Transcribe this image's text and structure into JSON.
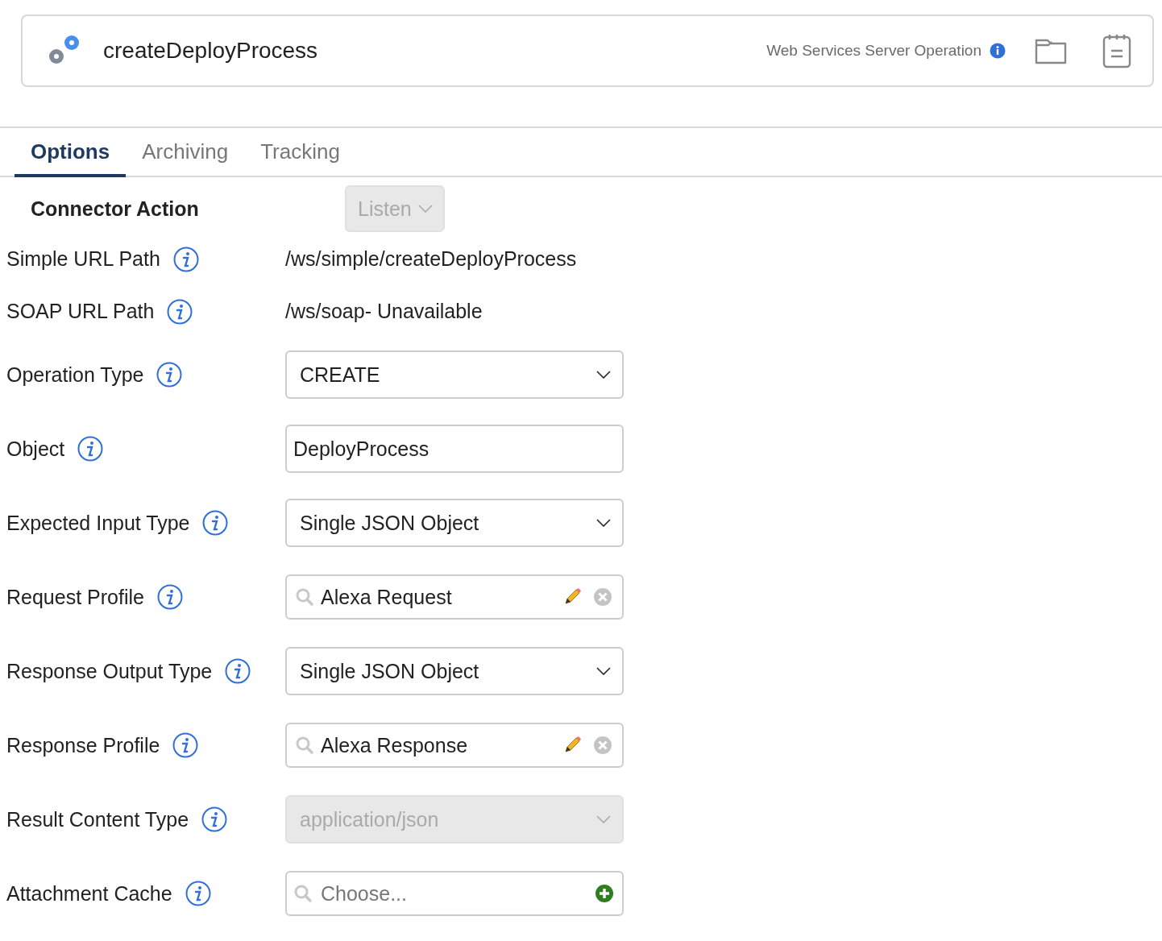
{
  "header": {
    "title": "createDeployProcess",
    "subtitle": "Web Services Server Operation"
  },
  "tabs": [
    {
      "label": "Options",
      "selected": true
    },
    {
      "label": "Archiving",
      "selected": false
    },
    {
      "label": "Tracking",
      "selected": false
    }
  ],
  "connector_action": {
    "label": "Connector Action",
    "value": "Listen",
    "disabled": true
  },
  "fields": [
    {
      "label": "Simple URL Path",
      "kind": "text",
      "value": "/ws/simple/createDeployProcess"
    },
    {
      "label": "SOAP URL Path",
      "kind": "text",
      "value": "/ws/soap- Unavailable"
    },
    {
      "label": "Operation Type",
      "kind": "select",
      "value": "CREATE",
      "disabled": false
    },
    {
      "label": "Object",
      "kind": "input",
      "value": "DeployProcess"
    },
    {
      "label": "Expected Input Type",
      "kind": "select",
      "value": "Single JSON Object",
      "disabled": false
    },
    {
      "label": "Request Profile",
      "kind": "profile",
      "value": "Alexa Request"
    },
    {
      "label": "Response Output Type",
      "kind": "select",
      "value": "Single JSON Object",
      "disabled": false
    },
    {
      "label": "Response Profile",
      "kind": "profile",
      "value": "Alexa Response"
    },
    {
      "label": "Result Content Type",
      "kind": "select",
      "value": "application/json",
      "disabled": true
    },
    {
      "label": "Attachment Cache",
      "kind": "chooser",
      "placeholder": "Choose..."
    }
  ]
}
